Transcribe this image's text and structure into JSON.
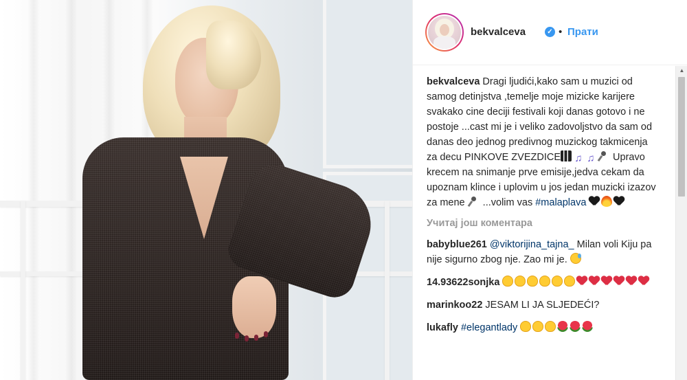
{
  "post": {
    "username": "bekvalceva",
    "verified_icon": "verified-badge-icon",
    "separator": "•",
    "follow_label": "Прати"
  },
  "caption": {
    "user": "bekvalceva",
    "text_part1": " Dragi ljudići,kako sam u muzici od samog detinjstva ,temelje moje mizicke karijere svakako cine deciji festivali koji danas gotovo i ne postoje ...cast mi je i veliko zadovoljstvo da sam od danas deo jednog predivnog muzickog takmicenja za decu PINKOVE ZVEZDICE",
    "emojis_1": [
      "piano-keys-icon",
      "music-notes-icon",
      "music-notes-icon",
      "microphone-icon"
    ],
    "text_part2": " Upravo krecem na snimanje prve emisije,jedva cekam da upoznam klince i uplovim u jos jedan muzicki izazov za mene ",
    "emojis_2": [
      "microphone-icon"
    ],
    "text_part3": " ...volim vas ",
    "hashtag": "#malaplava",
    "emojis_3": [
      "black-heart-icon",
      "fire-icon",
      "black-heart-icon"
    ]
  },
  "load_more_label": "Учитај још коментара",
  "comments": [
    {
      "user": "babyblue261",
      "mention": "@viktorijina_tajna_",
      "text": " Milan voli Kiju pa nije sigurno zbog nje. Zao mi je. ",
      "emojis": [
        "sweat-smile-icon"
      ]
    },
    {
      "user": "14.93622sonjka",
      "text": " ",
      "emojis": [
        "clap-icon",
        "clap-icon",
        "clap-icon",
        "clap-icon",
        "clap-icon",
        "clap-icon",
        "red-heart-icon",
        "red-heart-icon",
        "red-heart-icon",
        "red-heart-icon",
        "red-heart-icon",
        "red-heart-icon"
      ]
    },
    {
      "user": "marinkoo22",
      "text": " JESAM LI JA SLJEDEĆI?"
    },
    {
      "user": "lukafly",
      "hashtag": "#elegantlady",
      "emojis": [
        "clap-icon",
        "clap-icon",
        "clap-icon",
        "rose-icon",
        "rose-icon",
        "rose-icon"
      ]
    }
  ],
  "photo": {
    "description_icon": "post-photo"
  },
  "colors": {
    "link_blue": "#3897f0",
    "hashtag_blue": "#003569",
    "muted_gray": "#999999",
    "text": "#262626"
  }
}
